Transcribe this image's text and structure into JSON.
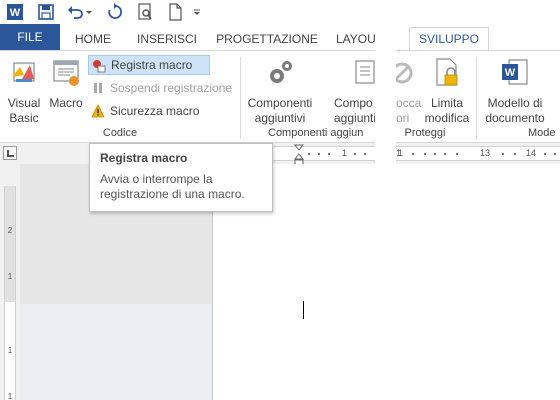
{
  "qat": {
    "icons": [
      "word-app-icon",
      "save-icon",
      "undo-icon",
      "redo-icon",
      "print-preview-icon",
      "new-document-icon",
      "customize-qat-icon"
    ]
  },
  "tabs": {
    "file": "FILE",
    "home": "HOME",
    "insert": "INSERISCI",
    "design": "PROGETTAZIONE",
    "layout": "LAYOU",
    "developer": "SVILUPPO"
  },
  "ribbon": {
    "code_group": {
      "visual_basic_line1": "Visual",
      "visual_basic_line2": "Basic",
      "macro": "Macro",
      "record_macro": "Registra macro",
      "pause_recording": "Sospendi registrazione",
      "macro_security": "Sicurezza macro",
      "label": "Codice"
    },
    "addins_group": {
      "addins1_line1": "Componenti",
      "addins1_line2": "aggiuntivi",
      "addins2_line1": "Compo",
      "addins2_line2": "aggiuntivi",
      "label": "Componenti aggiun"
    },
    "protect_group": {
      "block_line1": "occa",
      "block_line2": "ori",
      "restrict_line1": "Limita",
      "restrict_line2": "modifica",
      "label": "Proteggi"
    },
    "templates_group": {
      "template_line1": "Modello di",
      "template_line2": "documento",
      "label": "Mode"
    }
  },
  "ruler": {
    "numbers": [
      "1",
      "1",
      "1",
      "13",
      "14"
    ]
  },
  "vruler": {
    "numbers": [
      "2",
      "1",
      "1",
      "1"
    ]
  },
  "tooltip": {
    "title": "Registra macro",
    "body_line1": "Avvia o interrompe la",
    "body_line2": "registrazione di una macro."
  },
  "colors": {
    "file_tab": "#2b579a",
    "accent": "#2b579a",
    "highlight": "#cfe3f8"
  }
}
